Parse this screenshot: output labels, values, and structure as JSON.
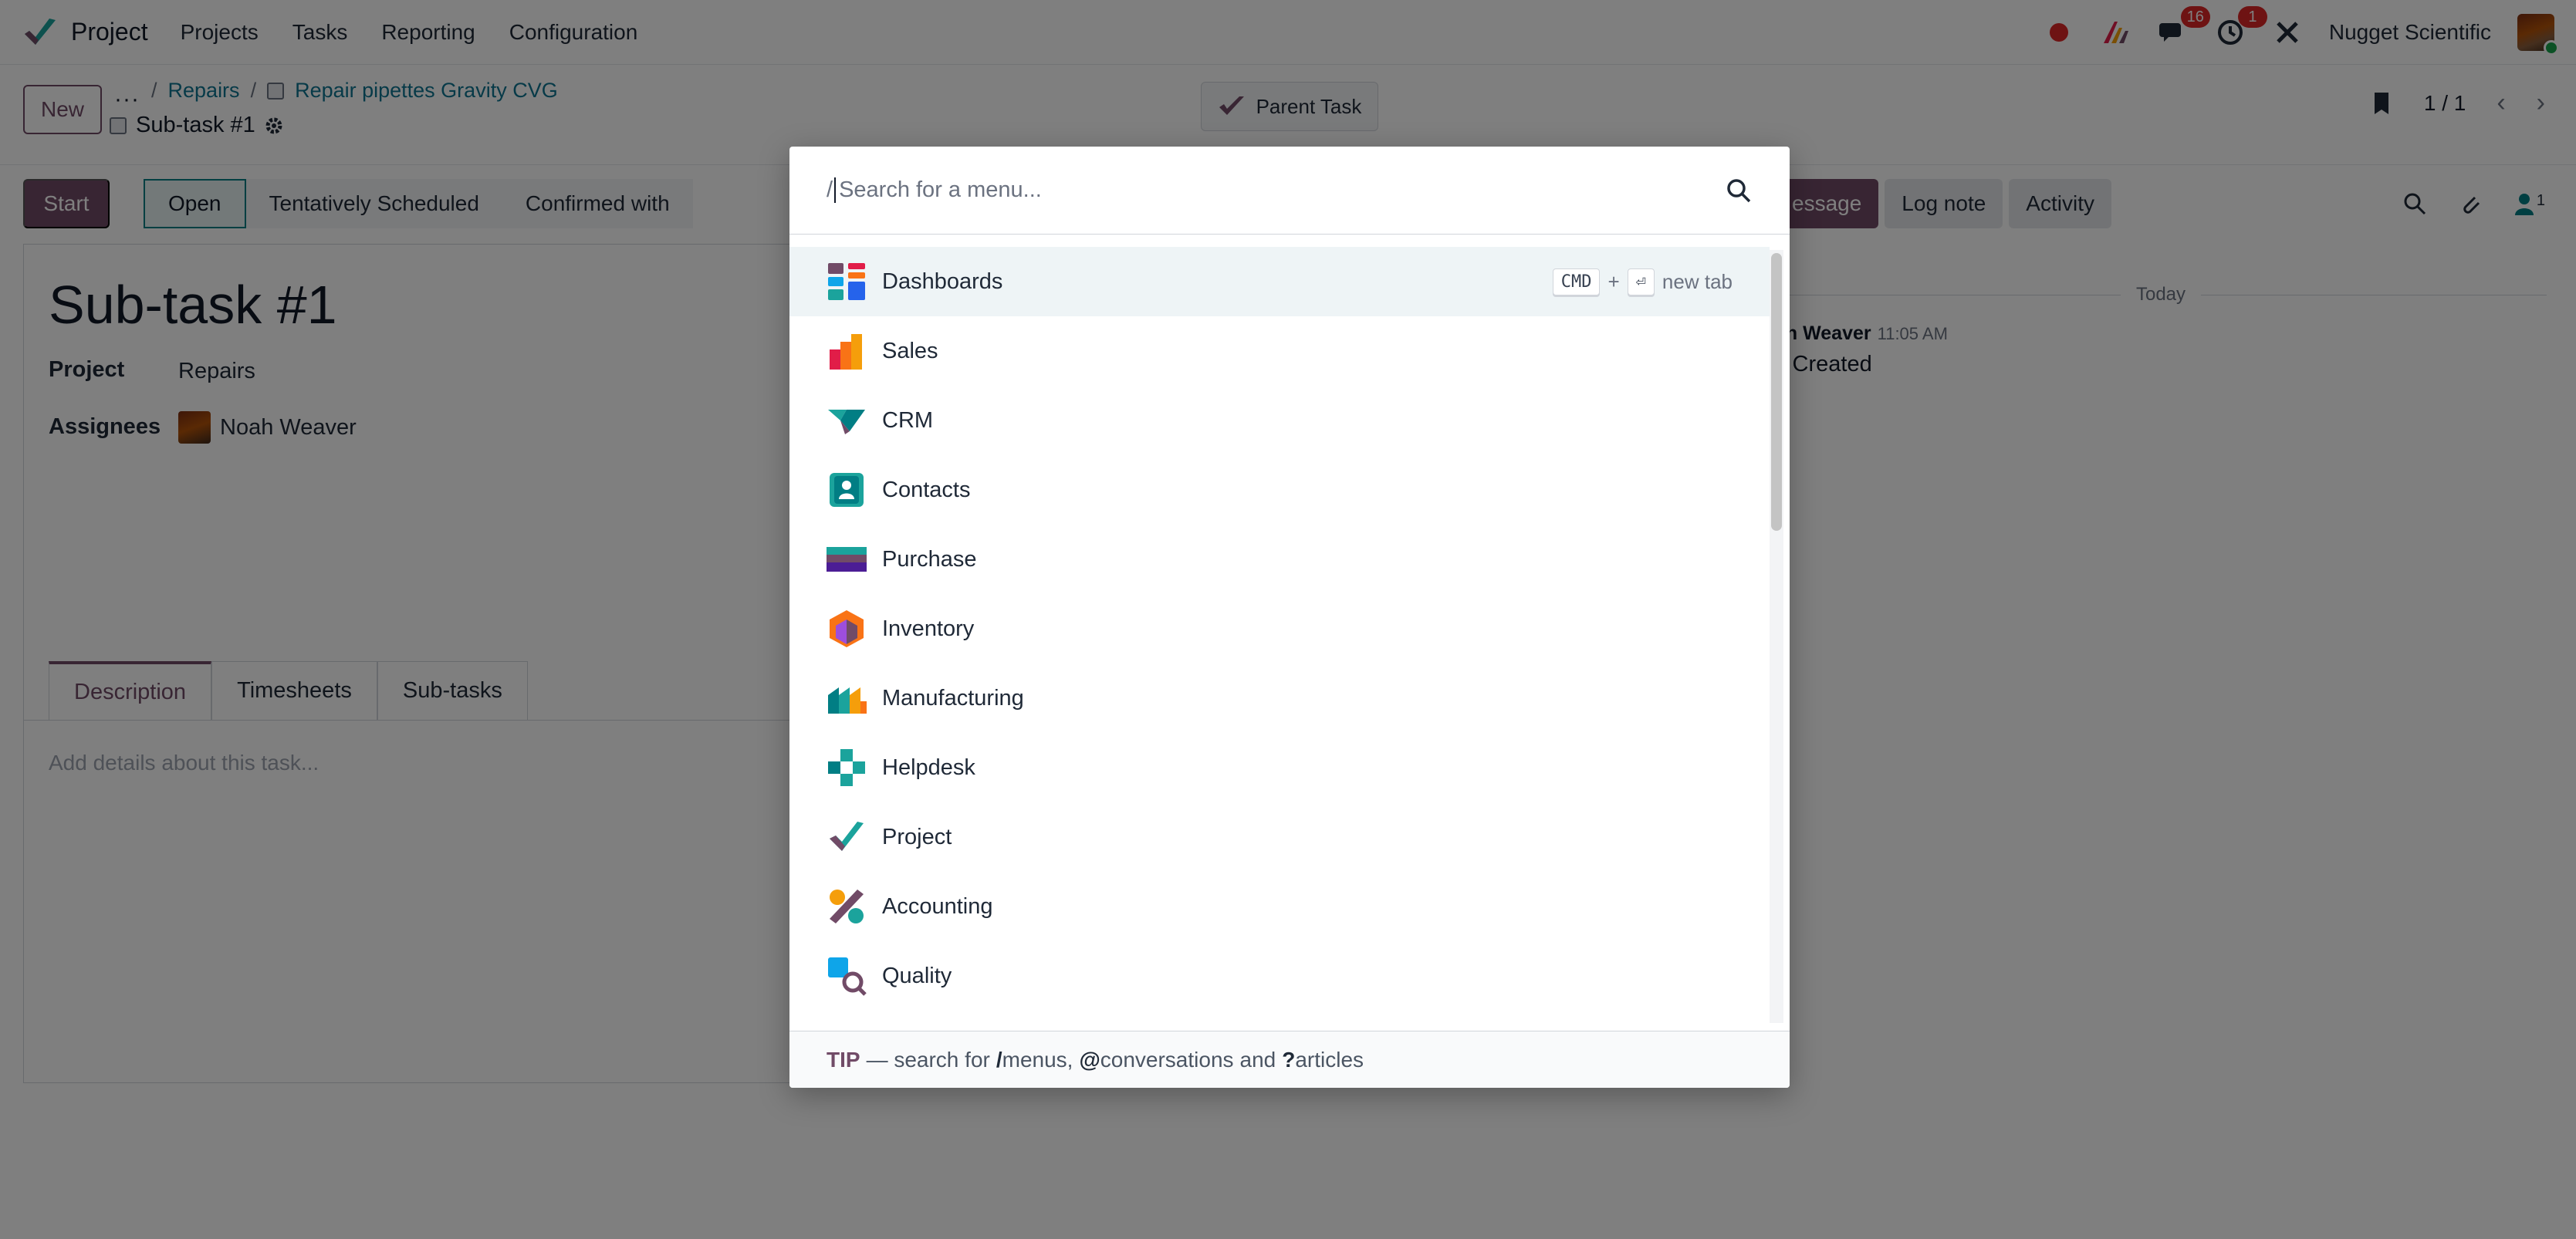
{
  "navbar": {
    "app_name": "Project",
    "menus": [
      "Projects",
      "Tasks",
      "Reporting",
      "Configuration"
    ],
    "messages_count": "16",
    "activities_count": "1",
    "company": "Nugget Scientific"
  },
  "control_panel": {
    "new_label": "New",
    "gear_label": "···",
    "breadcrumbs": [
      "Repairs",
      "Repair pipettes Gravity CVG"
    ],
    "current": "Sub-task #1",
    "parent_task_label": "Parent Task",
    "pager": "1 / 1"
  },
  "form": {
    "start_label": "Start",
    "stages": [
      "Open",
      "Tentatively Scheduled",
      "Confirmed with"
    ],
    "title": "Sub-task #1",
    "project_label": "Project",
    "project_value": "Repairs",
    "assignees_label": "Assignees",
    "assignee_name": "Noah Weaver",
    "tabs": [
      "Description",
      "Timesheets",
      "Sub-tasks"
    ],
    "description_placeholder": "Add details about this task..."
  },
  "chatter": {
    "send_message_label": "essage",
    "log_note_label": "Log note",
    "activity_label": "Activity",
    "followers_count": "1",
    "today_label": "Today",
    "author": "ah Weaver",
    "time": "11:05 AM",
    "body": "k Created"
  },
  "palette": {
    "prefix": "/",
    "placeholder": "Search for a menu...",
    "items": [
      {
        "label": "Dashboards",
        "icon": "dashboards-icon"
      },
      {
        "label": "Sales",
        "icon": "sales-icon"
      },
      {
        "label": "CRM",
        "icon": "crm-icon"
      },
      {
        "label": "Contacts",
        "icon": "contacts-icon"
      },
      {
        "label": "Purchase",
        "icon": "purchase-icon"
      },
      {
        "label": "Inventory",
        "icon": "inventory-icon"
      },
      {
        "label": "Manufacturing",
        "icon": "manufacturing-icon"
      },
      {
        "label": "Helpdesk",
        "icon": "helpdesk-icon"
      },
      {
        "label": "Project",
        "icon": "project-icon"
      },
      {
        "label": "Accounting",
        "icon": "accounting-icon"
      },
      {
        "label": "Quality",
        "icon": "quality-icon"
      }
    ],
    "hint": {
      "key1": "CMD",
      "plus": "+",
      "key2": "⏎",
      "text": "new tab"
    },
    "footer": {
      "tip": "TIP",
      "dash": "— search for",
      "menus_key": "/",
      "menus_word": "menus,",
      "conv_key": "@",
      "conv_word": "conversations",
      "and": "and",
      "art_key": "?",
      "art_word": "articles"
    }
  },
  "colors": {
    "brand": "#714b67",
    "teal": "#017e84",
    "badge": "#dc2626"
  }
}
